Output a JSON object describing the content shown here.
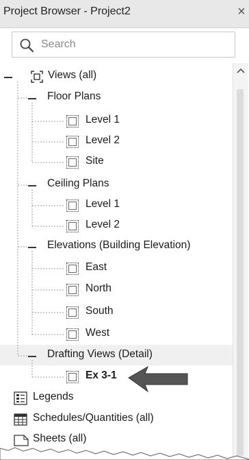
{
  "window": {
    "title": "Project Browser - Project2",
    "close_symbol": "×"
  },
  "search": {
    "placeholder": "Search"
  },
  "tree": {
    "root": "Views (all)",
    "floor_plans": {
      "label": "Floor Plans",
      "items": [
        "Level 1",
        "Level 2",
        "Site"
      ]
    },
    "ceiling_plans": {
      "label": "Ceiling Plans",
      "items": [
        "Level 1",
        "Level 2"
      ]
    },
    "elevations": {
      "label": "Elevations (Building Elevation)",
      "items": [
        "East",
        "North",
        "South",
        "West"
      ]
    },
    "drafting_views": {
      "label": "Drafting Views (Detail)",
      "items": [
        "Ex 3-1"
      ]
    },
    "legends": "Legends",
    "schedules": "Schedules/Quantities (all)",
    "sheets": "Sheets (all)"
  },
  "colors": {
    "titlebar": "#e8e8e8",
    "arrow": "#555555",
    "highlight_row": "#f0f0f0"
  }
}
